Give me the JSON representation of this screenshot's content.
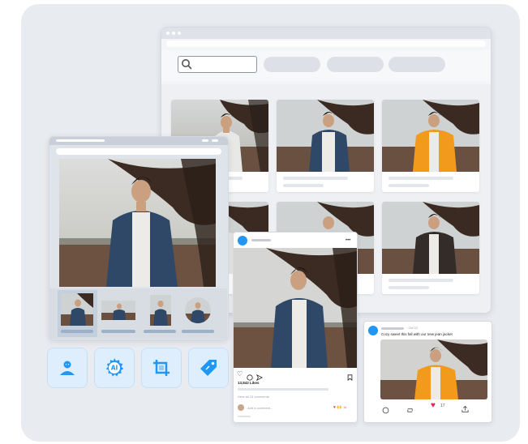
{
  "colors": {
    "background_panel": "#e8ebf0",
    "accent_blue": "#2196f3",
    "tool_bg": "#dfeefc",
    "like_red": "#e53935",
    "like_pink": "#e91e63"
  },
  "icons": {
    "search": "search-icon",
    "tools": [
      "user-avatar-icon",
      "ai-gear-icon",
      "crop-icon",
      "tag-icon"
    ],
    "post_actions": [
      "heart-icon",
      "comment-icon",
      "share-icon",
      "bookmark-icon"
    ],
    "tweet_actions": [
      "reply-icon",
      "retweet-icon",
      "like-icon",
      "share-icon"
    ]
  },
  "gallery": {
    "search_placeholder": "",
    "jacket_variants": [
      "white-tshirt",
      "denim-jacket",
      "orange-puffer-jacket",
      "white-tshirt",
      "denim-jacket",
      "black-leather-jacket"
    ]
  },
  "instagram_post": {
    "likes": "13,842 Likes",
    "view_comments": "View all 23 comments",
    "add_comment": "Add a comment...",
    "reactions": "♥ 🙌 ☺"
  },
  "tweet": {
    "date": "· Oct 12",
    "text": "Cozy sweet this fall with our new jean jacket",
    "like_count": "17"
  }
}
